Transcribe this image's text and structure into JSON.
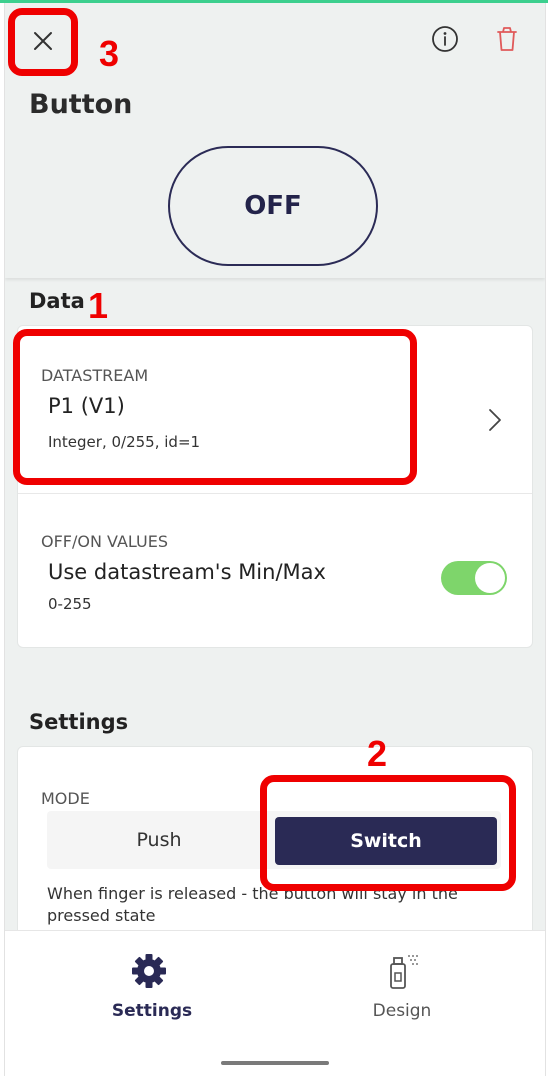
{
  "header": {
    "title": "Button",
    "close_icon": "close-icon",
    "info_icon": "info-icon",
    "trash_icon": "trash-icon",
    "button_state": "OFF"
  },
  "data_section": {
    "title": "Data",
    "datastream": {
      "label": "DATASTREAM",
      "value": "P1 (V1)",
      "details": "Integer, 0/255, id=1"
    },
    "offon": {
      "label": "OFF/ON VALUES",
      "value": "Use datastream's Min/Max",
      "range": "0-255",
      "toggle_on": true
    }
  },
  "settings_section": {
    "title": "Settings",
    "mode_label": "MODE",
    "options": [
      "Push",
      "Switch"
    ],
    "selected": "Switch",
    "description": "When finger is released - the button will stay in the pressed state"
  },
  "bottom_nav": {
    "items": [
      {
        "label": "Settings",
        "icon": "gear-icon",
        "active": true
      },
      {
        "label": "Design",
        "icon": "spray-can-icon",
        "active": false
      }
    ]
  },
  "annotations": [
    "1",
    "2",
    "3"
  ],
  "colors": {
    "accent_dark": "#2a2a55",
    "toggle_green": "#7ed56b",
    "annotation_red": "#ef0000",
    "top_line": "#3ccf8e",
    "trash_red": "#e05a5a"
  }
}
